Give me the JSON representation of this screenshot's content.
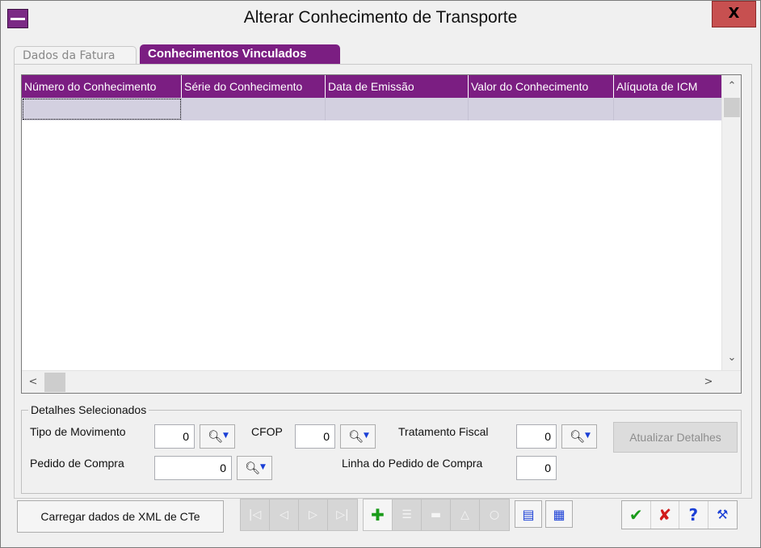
{
  "window": {
    "title": "Alterar Conhecimento de Transporte",
    "close_label": "X"
  },
  "tabs": [
    {
      "label": "Dados da Fatura",
      "active": false
    },
    {
      "label": "Conhecimentos Vinculados",
      "active": true
    }
  ],
  "grid": {
    "columns": [
      "Número do Conhecimento",
      "Série do Conhecimento",
      "Data de Emissão",
      "Valor do Conhecimento",
      "Alíquota de ICM"
    ],
    "rows": [
      [
        "",
        "",
        "",
        "",
        ""
      ]
    ],
    "header_color": "#7b1e82",
    "row_color": "#d3d0e0"
  },
  "details": {
    "group_title": "Detalhes Selecionados",
    "tipo_movimento_label": "Tipo de Movimento",
    "tipo_movimento_value": "0",
    "cfop_label": "CFOP",
    "cfop_value": "0",
    "tratamento_fiscal_label": "Tratamento Fiscal",
    "tratamento_fiscal_value": "0",
    "pedido_compra_label": "Pedido de Compra",
    "pedido_compra_value": "0",
    "linha_pedido_label": "Linha do Pedido de Compra",
    "linha_pedido_value": "0",
    "atualizar_label": "Atualizar Detalhes"
  },
  "footer": {
    "xml_button_label": "Carregar dados de XML de CTe"
  },
  "icons": {
    "nav": [
      "first-record-icon",
      "prev-record-icon",
      "next-record-icon",
      "last-record-icon"
    ],
    "edit": [
      "add-icon",
      "edit-icon",
      "remove-icon",
      "up-icon",
      "find-icon"
    ],
    "actions": [
      "confirm-icon",
      "cancel-icon",
      "help-icon",
      "tool-icon"
    ]
  },
  "colors": {
    "accent": "#7b1e82",
    "confirm": "#1a9b1a",
    "cancel": "#d11b1b",
    "help": "#1a3fd6"
  }
}
